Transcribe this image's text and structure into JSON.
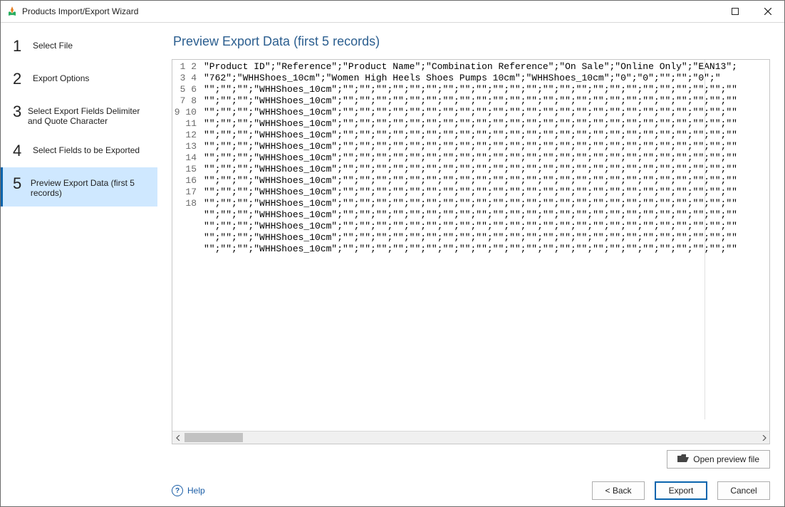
{
  "window": {
    "title": "Products Import/Export Wizard"
  },
  "steps": [
    {
      "num": "1",
      "label": "Select File"
    },
    {
      "num": "2",
      "label": "Export Options"
    },
    {
      "num": "3",
      "label": "Select Export Fields Delimiter and Quote Character"
    },
    {
      "num": "4",
      "label": "Select Fields to be Exported"
    },
    {
      "num": "5",
      "label": "Preview Export Data (first 5 records)"
    }
  ],
  "active_step_index": 4,
  "heading": "Preview Export Data (first 5 records)",
  "preview_button": "Open preview file",
  "help_label": "Help",
  "footer": {
    "back": "< Back",
    "export": "Export",
    "cancel": "Cancel"
  },
  "preview_lines": [
    "\"Product ID\";\"Reference\";\"Product Name\";\"Combination Reference\";\"On Sale\";\"Online Only\";\"EAN13\";",
    "\"762\";\"WHHShoes_10cm\";\"Women High Heels Shoes Pumps 10cm\";\"WHHShoes_10cm\";\"0\";\"0\";\"\";\"\";\"0\";\"",
    "\"\";\"\";\"\";\"WHHShoes_10cm\";\"\";\"\";\"\";\"\";\"\";\"\";\"\";\"\";\"\";\"\";\"\";\"\";\"\";\"\";\"\";\"\";\"\";\"\";\"\";\"\";\"\";\"\";\"\";\"\"",
    "\"\";\"\";\"\";\"WHHShoes_10cm\";\"\";\"\";\"\";\"\";\"\";\"\";\"\";\"\";\"\";\"\";\"\";\"\";\"\";\"\";\"\";\"\";\"\";\"\";\"\";\"\";\"\";\"\";\"\";\"\"",
    "\"\";\"\";\"\";\"WHHShoes_10cm\";\"\";\"\";\"\";\"\";\"\";\"\";\"\";\"\";\"\";\"\";\"\";\"\";\"\";\"\";\"\";\"\";\"\";\"\";\"\";\"\";\"\";\"\";\"\";\"\"",
    "\"\";\"\";\"\";\"WHHShoes_10cm\";\"\";\"\";\"\";\"\";\"\";\"\";\"\";\"\";\"\";\"\";\"\";\"\";\"\";\"\";\"\";\"\";\"\";\"\";\"\";\"\";\"\";\"\";\"\";\"\"",
    "\"\";\"\";\"\";\"WHHShoes_10cm\";\"\";\"\";\"\";\"\";\"\";\"\";\"\";\"\";\"\";\"\";\"\";\"\";\"\";\"\";\"\";\"\";\"\";\"\";\"\";\"\";\"\";\"\";\"\";\"\"",
    "\"\";\"\";\"\";\"WHHShoes_10cm\";\"\";\"\";\"\";\"\";\"\";\"\";\"\";\"\";\"\";\"\";\"\";\"\";\"\";\"\";\"\";\"\";\"\";\"\";\"\";\"\";\"\";\"\";\"\";\"\"",
    "\"\";\"\";\"\";\"WHHShoes_10cm\";\"\";\"\";\"\";\"\";\"\";\"\";\"\";\"\";\"\";\"\";\"\";\"\";\"\";\"\";\"\";\"\";\"\";\"\";\"\";\"\";\"\";\"\";\"\";\"\"",
    "\"\";\"\";\"\";\"WHHShoes_10cm\";\"\";\"\";\"\";\"\";\"\";\"\";\"\";\"\";\"\";\"\";\"\";\"\";\"\";\"\";\"\";\"\";\"\";\"\";\"\";\"\";\"\";\"\";\"\";\"\"",
    "\"\";\"\";\"\";\"WHHShoes_10cm\";\"\";\"\";\"\";\"\";\"\";\"\";\"\";\"\";\"\";\"\";\"\";\"\";\"\";\"\";\"\";\"\";\"\";\"\";\"\";\"\";\"\";\"\";\"\";\"\"",
    "\"\";\"\";\"\";\"WHHShoes_10cm\";\"\";\"\";\"\";\"\";\"\";\"\";\"\";\"\";\"\";\"\";\"\";\"\";\"\";\"\";\"\";\"\";\"\";\"\";\"\";\"\";\"\";\"\";\"\";\"\"",
    "\"\";\"\";\"\";\"WHHShoes_10cm\";\"\";\"\";\"\";\"\";\"\";\"\";\"\";\"\";\"\";\"\";\"\";\"\";\"\";\"\";\"\";\"\";\"\";\"\";\"\";\"\";\"\";\"\";\"\";\"\"",
    "\"\";\"\";\"\";\"WHHShoes_10cm\";\"\";\"\";\"\";\"\";\"\";\"\";\"\";\"\";\"\";\"\";\"\";\"\";\"\";\"\";\"\";\"\";\"\";\"\";\"\";\"\";\"\";\"\";\"\";\"\"",
    "\"\";\"\";\"\";\"WHHShoes_10cm\";\"\";\"\";\"\";\"\";\"\";\"\";\"\";\"\";\"\";\"\";\"\";\"\";\"\";\"\";\"\";\"\";\"\";\"\";\"\";\"\";\"\";\"\";\"\";\"\"",
    "\"\";\"\";\"\";\"WHHShoes_10cm\";\"\";\"\";\"\";\"\";\"\";\"\";\"\";\"\";\"\";\"\";\"\";\"\";\"\";\"\";\"\";\"\";\"\";\"\";\"\";\"\";\"\";\"\";\"\";\"\"",
    "\"\";\"\";\"\";\"WHHShoes_10cm\";\"\";\"\";\"\";\"\";\"\";\"\";\"\";\"\";\"\";\"\";\"\";\"\";\"\";\"\";\"\";\"\";\"\";\"\";\"\";\"\";\"\";\"\";\"\";\"\"",
    ""
  ]
}
